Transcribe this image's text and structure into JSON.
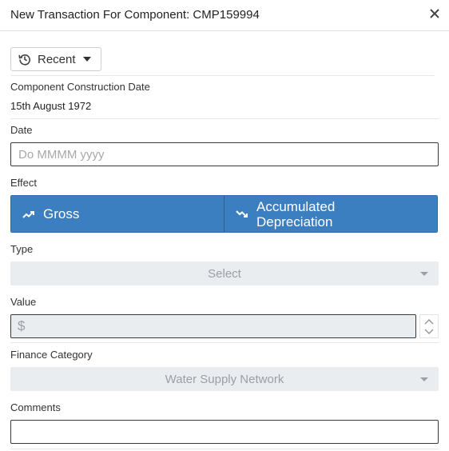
{
  "header": {
    "title": "New Transaction For Component: CMP159994",
    "close_icon": "close-icon"
  },
  "recent": {
    "label": "Recent",
    "icon": "history-icon"
  },
  "construction": {
    "label": "Component Construction Date",
    "value": "15th August 1972"
  },
  "date": {
    "label": "Date",
    "placeholder": "Do MMMM yyyy"
  },
  "effect": {
    "label": "Effect",
    "options": [
      {
        "label": "Gross",
        "icon": "trending-up-icon"
      },
      {
        "label": "Accumulated\nDepreciation",
        "icon": "trending-down-icon"
      }
    ],
    "accent": "#3c7fc0"
  },
  "type": {
    "label": "Type",
    "value": "Select"
  },
  "value": {
    "label": "Value",
    "currency": "$"
  },
  "finance": {
    "label": "Finance Category",
    "value": "Water Supply Network"
  },
  "comments": {
    "label": "Comments"
  }
}
